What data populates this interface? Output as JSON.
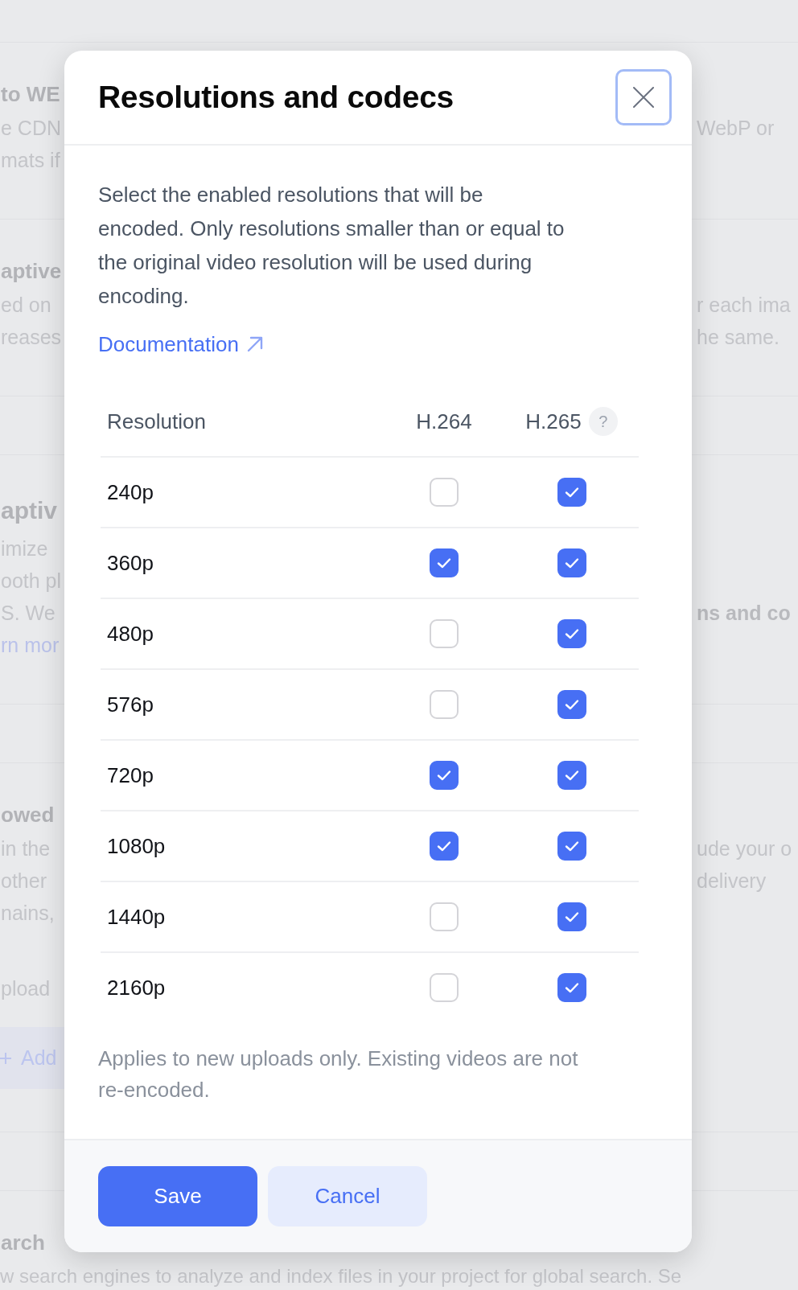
{
  "background": {
    "sections": [
      {
        "kind": "setting",
        "lines": [
          {
            "kind": "heading",
            "left": "to WE"
          },
          {
            "kind": "text",
            "left": "e CDN",
            "right": {
              "kind": "text",
              "text": "WebP or"
            }
          },
          {
            "kind": "text",
            "left": "mats if"
          }
        ]
      },
      {
        "kind": "setting",
        "lines": [
          {
            "kind": "heading",
            "left": "aptive"
          },
          {
            "kind": "text",
            "left": "ed on",
            "right": {
              "kind": "text",
              "text": "r each ima"
            }
          },
          {
            "kind": "text",
            "left": "reases",
            "right": {
              "kind": "text",
              "text": "he same."
            }
          }
        ]
      },
      {
        "kind": "empty"
      },
      {
        "kind": "setting",
        "lines": [
          {
            "kind": "title",
            "left": "aptiv"
          },
          {
            "kind": "text",
            "left": "imize"
          },
          {
            "kind": "text",
            "left": "ooth pl"
          },
          {
            "kind": "text",
            "left": "S. We",
            "right": {
              "kind": "label",
              "text": "ns and co"
            }
          },
          {
            "kind": "link",
            "left": "rn mor"
          }
        ]
      },
      {
        "kind": "empty"
      },
      {
        "kind": "setting",
        "lines": [
          {
            "kind": "heading",
            "left": "owed"
          },
          {
            "kind": "text",
            "left": "in the",
            "right": {
              "kind": "text",
              "text": "ude your o"
            }
          },
          {
            "kind": "text",
            "left": "other",
            "right": {
              "kind": "text",
              "text": "delivery"
            }
          },
          {
            "kind": "text",
            "left": "nains,"
          },
          {
            "kind": "caption",
            "left": "pload"
          },
          {
            "kind": "add",
            "label": "Add"
          }
        ]
      },
      {
        "kind": "empty"
      },
      {
        "kind": "setting",
        "lines": [
          {
            "kind": "heading",
            "left": "arch"
          },
          {
            "kind": "wide",
            "left": "w search engines to analyze and index files in your project for global search. Se"
          }
        ]
      }
    ]
  },
  "dialog": {
    "title": "Resolutions and codecs",
    "description": "Select the enabled resolutions that will be encoded. Only resolutions smaller than or equal to the original video resolution will be used during encoding.",
    "link": "Documentation",
    "table": {
      "columns": [
        {
          "label": "Resolution"
        },
        {
          "label": "H.264"
        },
        {
          "label": "H.265",
          "help": "?"
        }
      ],
      "rows": [
        {
          "label": "240p",
          "cells": [
            {
              "checked": false
            },
            {
              "checked": true
            }
          ]
        },
        {
          "label": "360p",
          "cells": [
            {
              "checked": true
            },
            {
              "checked": true
            }
          ]
        },
        {
          "label": "480p",
          "cells": [
            {
              "checked": false
            },
            {
              "checked": true
            }
          ]
        },
        {
          "label": "576p",
          "cells": [
            {
              "checked": false
            },
            {
              "checked": true
            }
          ]
        },
        {
          "label": "720p",
          "cells": [
            {
              "checked": true
            },
            {
              "checked": true
            }
          ]
        },
        {
          "label": "1080p",
          "cells": [
            {
              "checked": true
            },
            {
              "checked": true
            }
          ]
        },
        {
          "label": "1440p",
          "cells": [
            {
              "checked": false
            },
            {
              "checked": true
            }
          ]
        },
        {
          "label": "2160p",
          "cells": [
            {
              "checked": false
            },
            {
              "checked": true
            }
          ]
        }
      ]
    },
    "note": "Applies to new uploads only. Existing videos are not re-encoded.",
    "buttons": [
      {
        "label": "Save",
        "kind": "primary"
      },
      {
        "label": "Cancel",
        "kind": "secondary"
      }
    ]
  }
}
